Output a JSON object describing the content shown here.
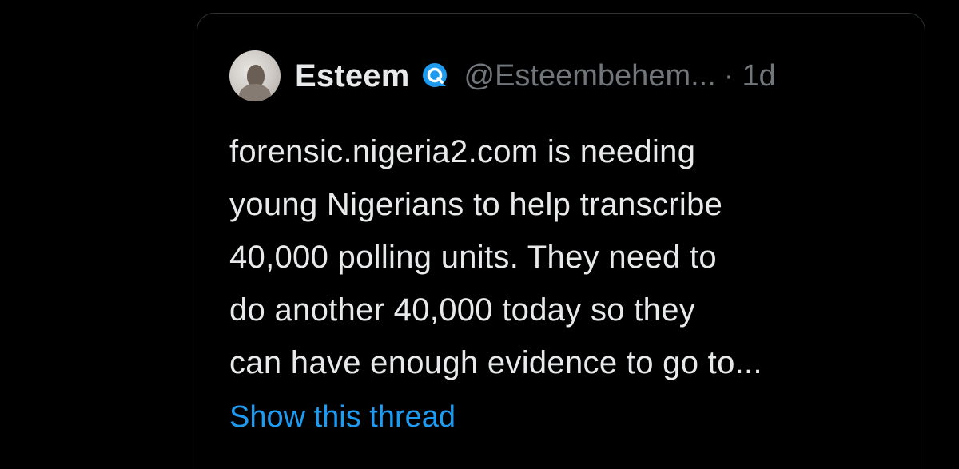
{
  "quoted_tweet": {
    "author": {
      "display_name": "Esteem",
      "handle": "@Esteembehem...",
      "verified_badge_icon": "verified-badge-icon",
      "avatar_icon": "avatar-image"
    },
    "separator": "·",
    "timestamp": "1d",
    "text_lines": [
      "forensic.nigeria2.com is needing",
      "young Nigerians to help transcribe",
      "40,000 polling units. They need to",
      "do another 40,000 today so they",
      "can have enough evidence to go to..."
    ],
    "show_thread_label": "Show this thread"
  },
  "colors": {
    "background": "#000000",
    "border": "#2f3336",
    "primary_text": "#e7e9ea",
    "secondary_text": "#71767b",
    "link": "#1d9bf0"
  }
}
